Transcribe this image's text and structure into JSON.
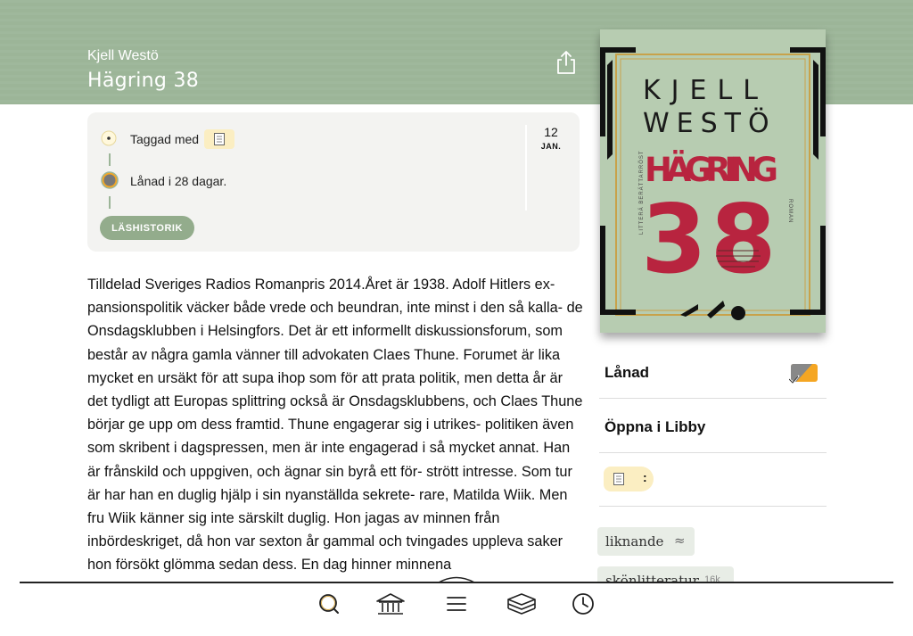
{
  "header": {
    "author": "Kjell Westö",
    "title": "Hägring 38"
  },
  "history": {
    "tagged_label": "Taggad med",
    "loan_label": "Lånad i 28 dagar.",
    "history_button": "LÄSHISTORIK",
    "date_day": "12",
    "date_month": "JAN."
  },
  "description": "Tilldelad Sveriges Radios Romanpris 2014.Året är 1938. Adolf Hitlers ex- pansionspolitik väcker både vrede och beundran, inte minst i den så kalla- de Onsdagsklubben i Helsingfors. Det är ett informellt diskussionsforum, som består av några gamla vänner till advokaten Claes Thune. Forumet är lika mycket en ursäkt för att supa ihop som för att prata politik, men detta år är det tydligt att Europas splittring också är Onsdagsklubbens, och Claes Thune börjar ge upp om dess framtid. Thune engagerar sig i utrikes- politiken även som skribent i dagspressen, men är inte engagerad i så mycket annat. Han är frånskild och uppgiven, och ägnar sin byrå ett för- strött intresse. Som tur är har han en duglig hjälp i sin nyanställda sekrete- rare, Matilda Wiik. Men fru Wiik känner sig inte särskilt duglig. Hon jagas av minnen från inbördeskriget, då hon var sexton år gammal och tvingades uppleva saker hon försökt glömma sedan dess. En dag hinner minnena",
  "cover": {
    "line1": "KJELL",
    "line2": "WESTÖ",
    "line3": "HÄGRING",
    "line4": "38",
    "spine_left": "LITTERÄ BERÄTTARRÖST",
    "spine_right": "ROMAN"
  },
  "sidebar": {
    "status_label": "Lånad",
    "open_label": "Öppna i Libby",
    "shelf_colon": ":",
    "tags": [
      {
        "label": "liknande",
        "symbol": "≈"
      },
      {
        "label": "skönlitteratur",
        "count": "16k"
      }
    ]
  },
  "tabs": [
    "search",
    "library",
    "menu",
    "shelf",
    "timeline"
  ],
  "colors": {
    "header_bg": "#9cb598",
    "accent_green": "#93ac8c",
    "tag_yellow": "#fbeec2",
    "loan_orange": "#f5a623",
    "cover_red": "#b8243f"
  }
}
